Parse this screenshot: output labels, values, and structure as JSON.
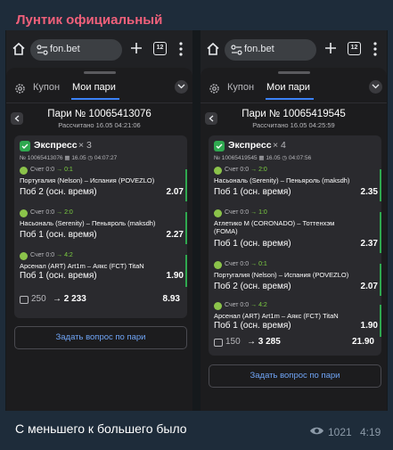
{
  "channel": {
    "title": "Лунтик официальный"
  },
  "browser": {
    "url": "fon.bet",
    "tab_count": "12"
  },
  "sheet_tabs": {
    "coupon": "Купон",
    "my_bets": "Мои пари"
  },
  "left_bet": {
    "title": "Пари № 10065413076",
    "calculated": "Рассчитано 16.05 04:21:06",
    "express": "Экспресс",
    "count": "× 3",
    "meta_id": "№ 10065413076",
    "meta_date": "16.05",
    "meta_time": "04:07:27",
    "events": [
      {
        "score_label": "Счет 0:0",
        "score_live": "→ 0:1",
        "teams": "Португалия (Nelson) – Испания (POVEZLO)",
        "market": "Поб 2 (осн. время)",
        "odd": "2.07"
      },
      {
        "score_label": "Счет 0:0",
        "score_live": "→ 2:0",
        "teams": "Насьональ (Serenity) – Пеньяроль (maksdh)",
        "market": "Поб 1 (осн. время)",
        "odd": "2.27"
      },
      {
        "score_label": "Счет 0:0",
        "score_live": "→ 4:2",
        "teams": "Арсенал (ART) Art1m – Аякс (FCT) TitaN",
        "market": "Поб 1 (осн. время)",
        "odd": "1.90"
      }
    ],
    "stake": "250",
    "payout": "→ 2 233",
    "total_odd": "8.93",
    "ask_button": "Задать вопрос по пари"
  },
  "right_bet": {
    "title": "Пари № 10065419545",
    "calculated": "Рассчитано 16.05 04:25:59",
    "express": "Экспресс",
    "count": "× 4",
    "meta_id": "№ 10065419545",
    "meta_date": "16.05",
    "meta_time": "04:07:56",
    "events": [
      {
        "score_label": "Счет 0:0",
        "score_live": "→ 2:0",
        "teams": "Насьональ (Serenity) – Пеньяроль (maksdh)",
        "market": "Поб 1 (осн. время)",
        "odd": "2.35"
      },
      {
        "score_label": "Счет 0:0",
        "score_live": "→ 1:0",
        "teams": "Атлетико М (CORONADO) – Тоттенхэм (FOMA)",
        "market": "Поб 1 (осн. время)",
        "odd": "2.37"
      },
      {
        "score_label": "Счет 0:0",
        "score_live": "→ 0:1",
        "teams": "Португалия (Nelson) – Испания (POVEZLO)",
        "market": "Поб 2 (осн. время)",
        "odd": "2.07"
      },
      {
        "score_label": "Счет 0:0",
        "score_live": "→ 4:2",
        "teams": "Арсенал (ART) Art1m – Аякс (FCT) TitaN",
        "market": "Поб 1 (осн. время)",
        "odd": "1.90"
      }
    ],
    "stake": "150",
    "payout": "→ 3 285",
    "total_odd": "21.90",
    "ask_button": "Задать вопрос по пари"
  },
  "post": {
    "caption": "С меньшего к большего было",
    "views": "1021",
    "time": "4:19"
  },
  "colors": {
    "accent_green": "#2fa84f",
    "link_blue": "#6fa4f5",
    "channel_name": "#f0607a",
    "live_score": "#7ccf42"
  }
}
